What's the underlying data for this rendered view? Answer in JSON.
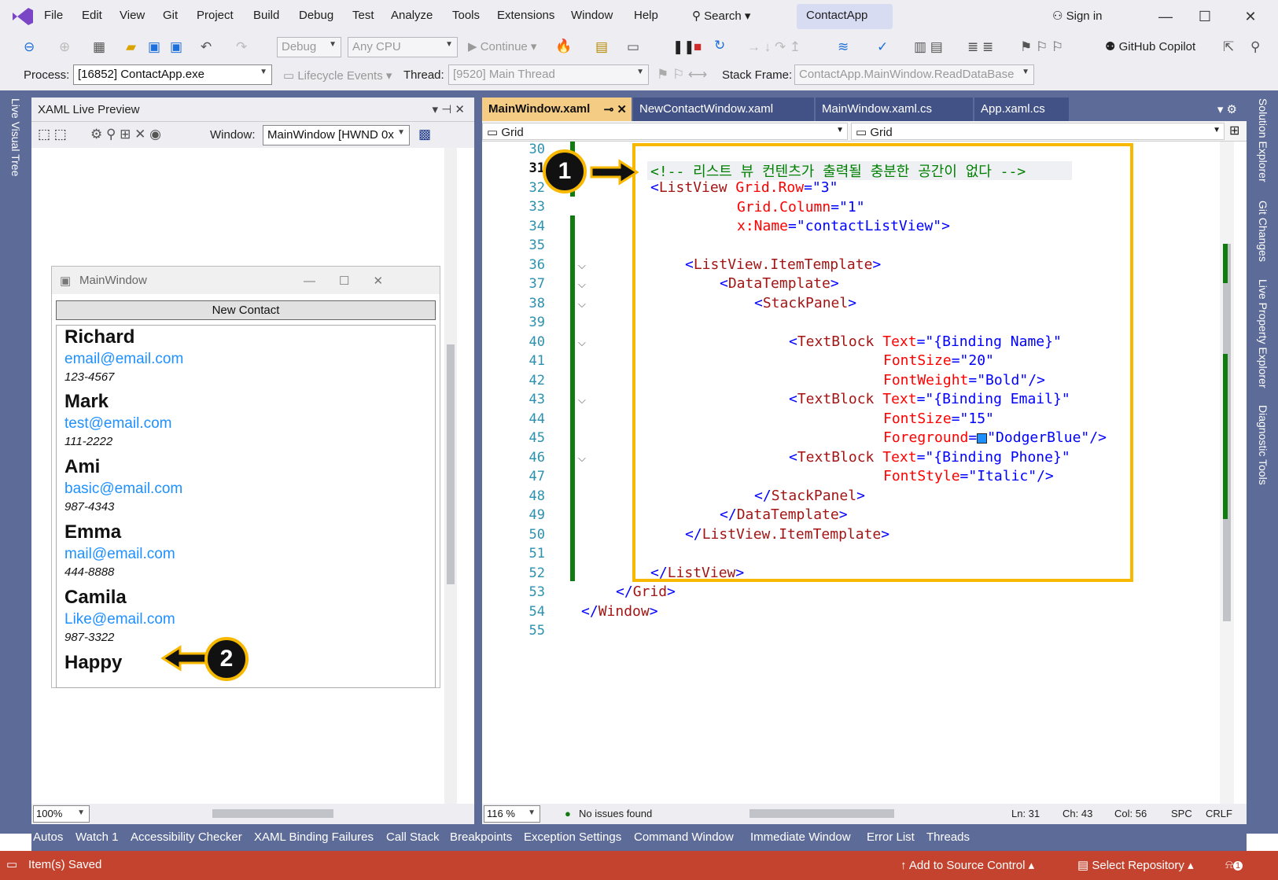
{
  "menu": {
    "items": [
      "File",
      "Edit",
      "View",
      "Git",
      "Project",
      "Build",
      "Debug",
      "Test",
      "Analyze",
      "Tools",
      "Extensions",
      "Window",
      "Help"
    ],
    "search": "Search",
    "app_name": "ContactApp",
    "sign_in": "Sign in"
  },
  "toolbar1": {
    "config": "Debug",
    "platform": "Any CPU",
    "continue": "Continue",
    "copilot": "GitHub Copilot"
  },
  "toolbar2": {
    "process_label": "Process:",
    "process": "[16852] ContactApp.exe",
    "lifecycle": "Lifecycle Events",
    "thread_label": "Thread:",
    "thread": "[9520] Main Thread",
    "stack_label": "Stack Frame:",
    "stack": "ContactApp.MainWindow.ReadDataBase"
  },
  "left_sidebar": {
    "tab": "Live Visual Tree"
  },
  "xaml_preview": {
    "title": "XAML Live Preview",
    "window_label": "Window:",
    "window_value": "MainWindow [HWND 0x",
    "zoom": "100%"
  },
  "preview_window": {
    "title": "MainWindow",
    "new_contact": "New Contact",
    "contacts": [
      {
        "name": "Richard",
        "email": "email@email.com",
        "phone": "123-4567"
      },
      {
        "name": "Mark",
        "email": "test@email.com",
        "phone": "111-2222"
      },
      {
        "name": "Ami",
        "email": "basic@email.com",
        "phone": "987-4343"
      },
      {
        "name": "Emma",
        "email": "mail@email.com",
        "phone": "444-8888"
      },
      {
        "name": "Camila",
        "email": "Like@email.com",
        "phone": "987-3322"
      },
      {
        "name": "Happy",
        "email": "",
        "phone": ""
      }
    ]
  },
  "editor": {
    "tabs": [
      "MainWindow.xaml",
      "NewContactWindow.xaml",
      "MainWindow.xaml.cs",
      "App.xaml.cs"
    ],
    "nav_left": "Grid",
    "nav_right": "Grid",
    "line_numbers": [
      "30",
      "31",
      "32",
      "33",
      "34",
      "35",
      "36",
      "37",
      "38",
      "39",
      "40",
      "41",
      "42",
      "43",
      "44",
      "45",
      "46",
      "47",
      "48",
      "49",
      "50",
      "51",
      "52",
      "53",
      "54",
      "55"
    ],
    "comment": "<!-- 리스트 뷰 컨텐츠가 출력될 충분한 공간이 없다 -->",
    "zoom": "116 %",
    "issues": "No issues found",
    "ln": "Ln: 31",
    "ch": "Ch: 43",
    "col": "Col: 56",
    "spc": "SPC",
    "crlf": "CRLF"
  },
  "callouts": {
    "one": "1",
    "two": "2"
  },
  "right_sidebar": [
    "Solution Explorer",
    "Git Changes",
    "Live Property Explorer",
    "Diagnostic Tools"
  ],
  "bottom_tabs": [
    "Autos",
    "Watch 1",
    "Accessibility Checker",
    "XAML Binding Failures",
    "Call Stack",
    "Breakpoints",
    "Exception Settings",
    "Command Window",
    "Immediate Window",
    "Error List",
    "Threads"
  ],
  "footer": {
    "status": "Item(s) Saved",
    "source_control": "Add to Source Control",
    "repo": "Select Repository",
    "notifications": "1"
  }
}
